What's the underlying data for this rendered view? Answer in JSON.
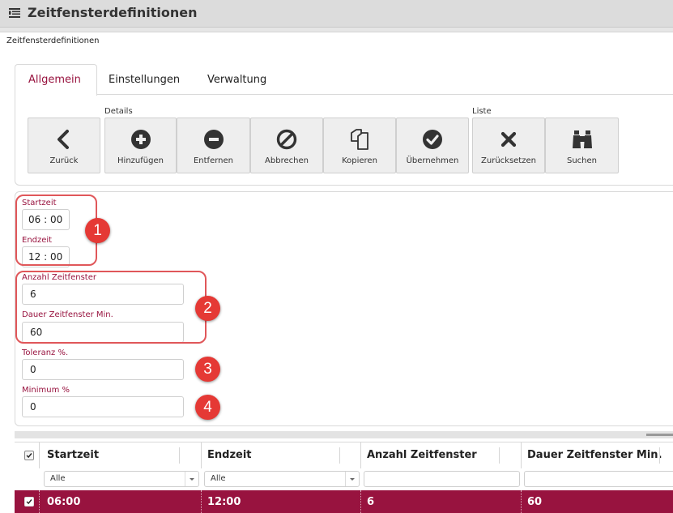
{
  "window": {
    "title": "Zeitfensterdefinitionen",
    "icon": "list-settings-icon"
  },
  "breadcrumb": {
    "label": "Zeitfensterdefinitionen"
  },
  "tabs": [
    {
      "label": "Allgemein",
      "active": true
    },
    {
      "label": "Einstellungen",
      "active": false
    },
    {
      "label": "Verwaltung",
      "active": false
    }
  ],
  "toolbar": {
    "groups": {
      "details": "Details",
      "liste": "Liste"
    },
    "buttons": {
      "back": {
        "label": "Zurück",
        "icon": "chevron-left-icon"
      },
      "add": {
        "label": "Hinzufügen",
        "icon": "plus-circle-icon"
      },
      "remove": {
        "label": "Entfernen",
        "icon": "minus-circle-icon"
      },
      "cancel": {
        "label": "Abbrechen",
        "icon": "ban-icon"
      },
      "copy": {
        "label": "Kopieren",
        "icon": "copy-icon"
      },
      "apply": {
        "label": "Übernehmen",
        "icon": "check-circle-icon"
      },
      "reset": {
        "label": "Zurücksetzen",
        "icon": "close-x-icon"
      },
      "search": {
        "label": "Suchen",
        "icon": "binoculars-icon"
      }
    }
  },
  "form": {
    "startzeit": {
      "label": "Startzeit",
      "value": "06 : 00"
    },
    "endzeit": {
      "label": "Endzeit",
      "value": "12 : 00"
    },
    "anzahl": {
      "label": "Anzahl Zeitfenster",
      "value": "6"
    },
    "dauer": {
      "label": "Dauer Zeitfenster Min.",
      "value": "60"
    },
    "toleranz": {
      "label": "Toleranz %.",
      "value": "0"
    },
    "minimum": {
      "label": "Minimum %",
      "value": "0"
    }
  },
  "annotations": {
    "one": "1",
    "two": "2",
    "three": "3",
    "four": "4"
  },
  "grid": {
    "headers": {
      "startzeit": "Startzeit",
      "endzeit": "Endzeit",
      "anzahl": "Anzahl Zeitfenster",
      "dauer": "Dauer Zeitfenster Min."
    },
    "filters": {
      "startzeit": "Alle",
      "endzeit": "Alle"
    },
    "rows": [
      {
        "startzeit": "06:00",
        "endzeit": "12:00",
        "anzahl": "6",
        "dauer": "60",
        "selected": true
      }
    ]
  },
  "colors": {
    "accent": "#98133f",
    "annotation": "#e53935"
  }
}
